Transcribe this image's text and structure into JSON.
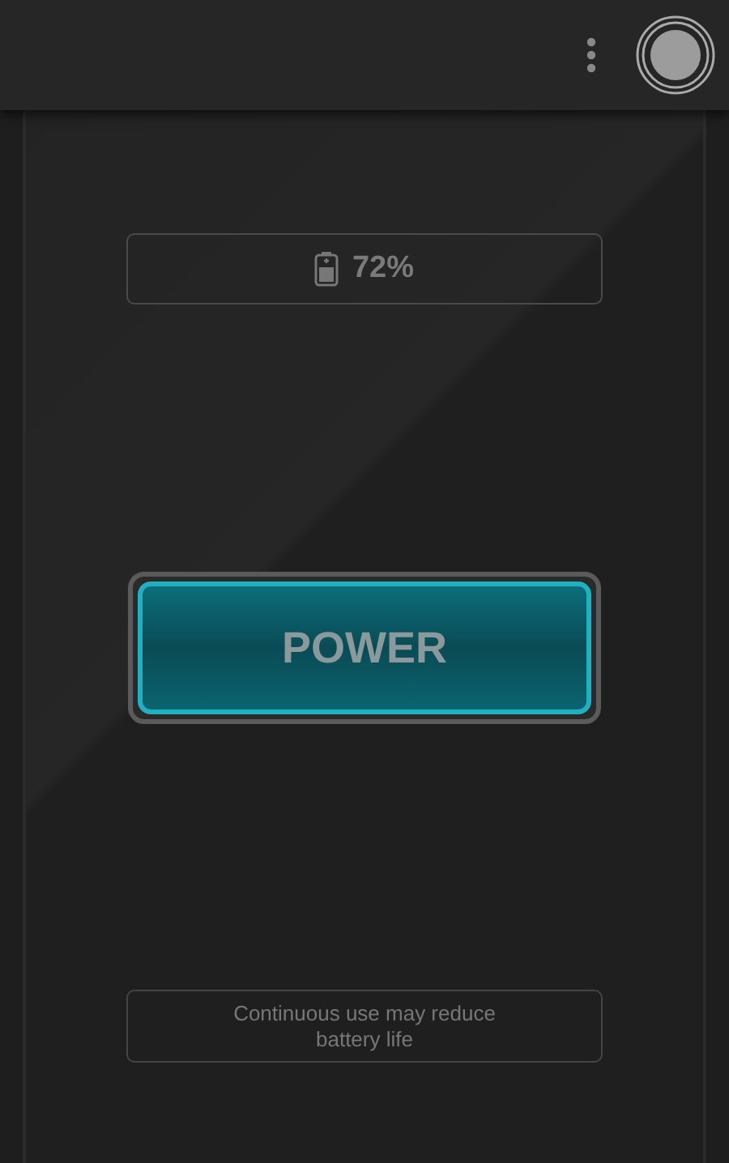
{
  "battery": {
    "percent": "72%"
  },
  "power_button": {
    "label": "POWER"
  },
  "note": "Continuous use may reduce battery life"
}
